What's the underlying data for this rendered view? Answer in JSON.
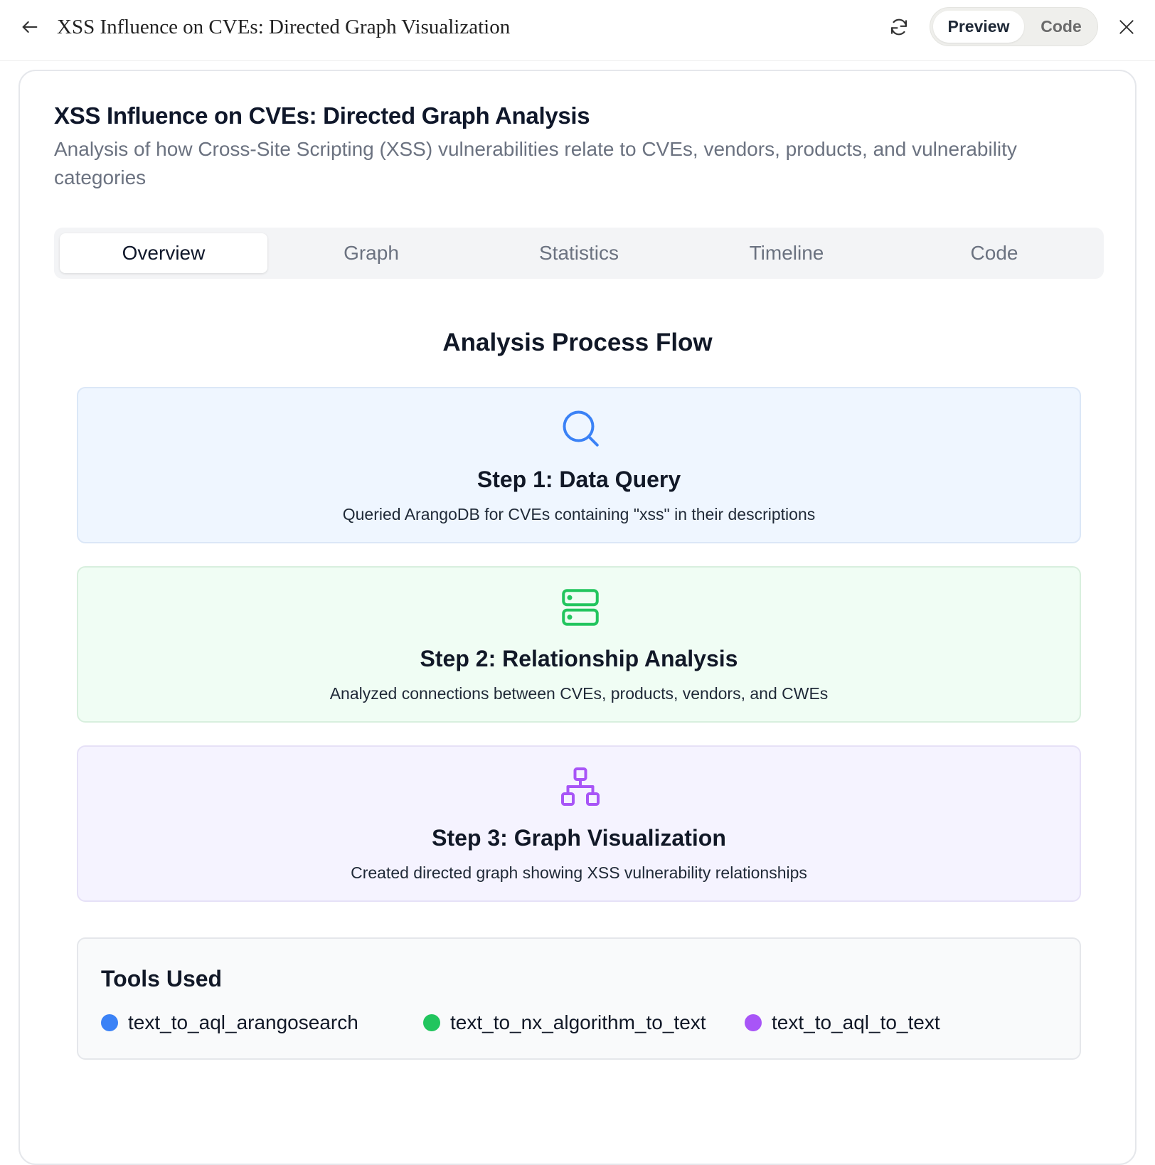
{
  "window": {
    "title": "XSS Influence on CVEs: Directed Graph Visualization",
    "view_toggle": {
      "preview_label": "Preview",
      "code_label": "Code",
      "selected": "Preview"
    }
  },
  "header": {
    "title": "XSS Influence on CVEs: Directed Graph Analysis",
    "subtitle": "Analysis of how Cross-Site Scripting (XSS) vulnerabilities relate to CVEs, vendors, products, and vulnerability categories"
  },
  "tabs": [
    {
      "label": "Overview",
      "active": true
    },
    {
      "label": "Graph",
      "active": false
    },
    {
      "label": "Statistics",
      "active": false
    },
    {
      "label": "Timeline",
      "active": false
    },
    {
      "label": "Code",
      "active": false
    }
  ],
  "process": {
    "heading": "Analysis Process Flow",
    "steps": [
      {
        "title": "Step 1: Data Query",
        "description": "Queried ArangoDB for CVEs containing \"xss\" in their descriptions",
        "icon": "search-icon",
        "color": "#3b82f6",
        "background": "#eff6ff"
      },
      {
        "title": "Step 2: Relationship Analysis",
        "description": "Analyzed connections between CVEs, products, vendors, and CWEs",
        "icon": "server-icon",
        "color": "#22c55e",
        "background": "#f0fdf4"
      },
      {
        "title": "Step 3: Graph Visualization",
        "description": "Created directed graph showing XSS vulnerability relationships",
        "icon": "network-icon",
        "color": "#a855f7",
        "background": "#f5f3ff"
      }
    ]
  },
  "tools": {
    "title": "Tools Used",
    "items": [
      {
        "label": "text_to_aql_arangosearch",
        "color": "#3b82f6"
      },
      {
        "label": "text_to_nx_algorithm_to_text",
        "color": "#22c55e"
      },
      {
        "label": "text_to_aql_to_text",
        "color": "#a855f7"
      }
    ]
  }
}
